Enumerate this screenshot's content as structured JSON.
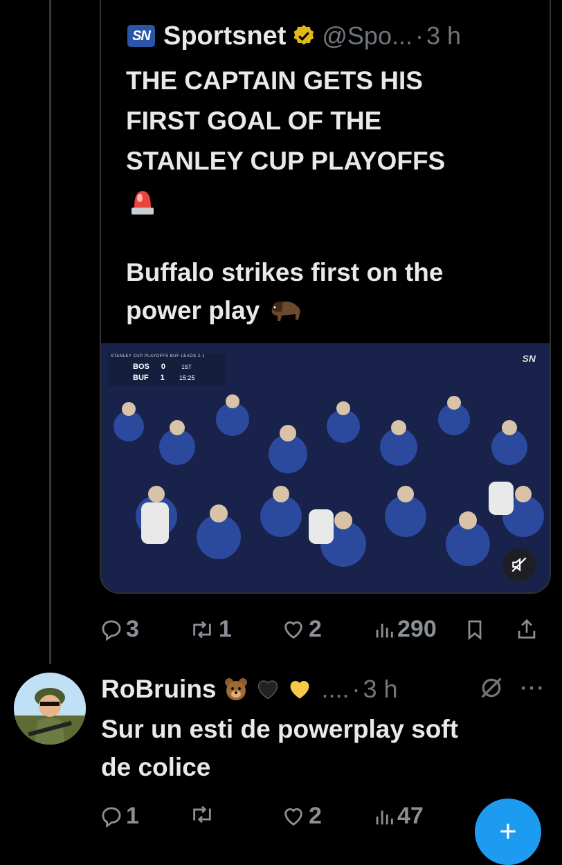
{
  "quoted_tweet": {
    "logo_text": "SN",
    "author_name": "Sportsnet",
    "handle": "@Spo...",
    "separator": "·",
    "time": "3 h",
    "headline_lines": [
      "THE CAPTAIN GETS HIS",
      "FIRST GOAL OF THE",
      "STANLEY CUP PLAYOFFS"
    ],
    "body_lines": [
      "Buffalo strikes first on the",
      "power play"
    ],
    "video": {
      "scorebug_top": "STANLEY CUP PLAYOFFS    BUF LEADS 2-1",
      "team1": "BOS",
      "score1": "0",
      "team2": "BUF",
      "score2": "1",
      "period": "1ST",
      "clock": "15:25",
      "watermark": "SN",
      "muted": true
    }
  },
  "tweet_actions": {
    "replies": "3",
    "reposts": "1",
    "likes": "2",
    "views": "290"
  },
  "reply": {
    "author_name": "RoBruins",
    "handle": "....",
    "separator": "·",
    "time": "3 h",
    "more_label": "···",
    "text_lines": [
      "Sur un esti de powerplay soft",
      "de colice"
    ],
    "actions": {
      "replies": "1",
      "likes": "2",
      "views": "47"
    }
  },
  "fab": {
    "label": "+"
  },
  "colors": {
    "background": "#000000",
    "text": "#e7e9ea",
    "muted": "#71767b",
    "accent": "#1d9bf0",
    "verified_gold": "#e2b719"
  }
}
